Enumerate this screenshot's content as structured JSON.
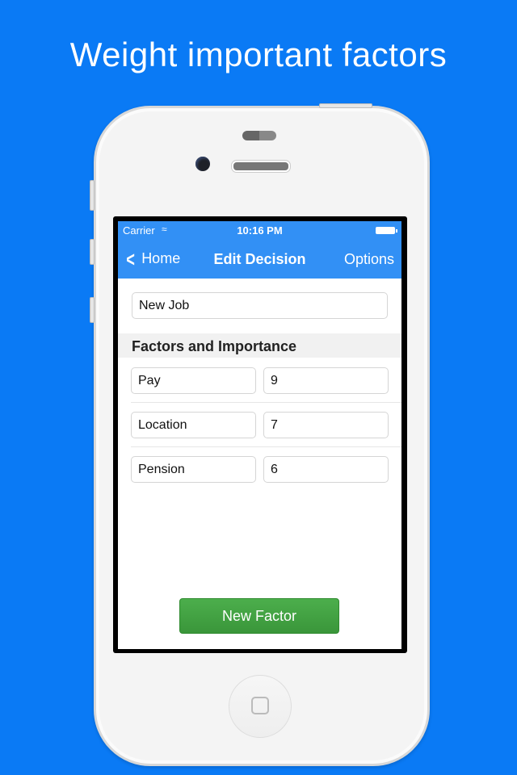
{
  "headline": "Weight important factors",
  "status_bar": {
    "carrier": "Carrier",
    "wifi_icon": "wifi-icon",
    "time": "10:16 PM",
    "battery_icon": "battery-icon"
  },
  "nav_bar": {
    "back_label": "Home",
    "back_icon": "chevron-left-icon",
    "title": "Edit Decision",
    "right_label": "Options"
  },
  "decision_name": {
    "value": "New Job"
  },
  "section_header": "Factors and Importance",
  "factors": [
    {
      "name": "Pay",
      "importance": "9"
    },
    {
      "name": "Location",
      "importance": "7"
    },
    {
      "name": "Pension",
      "importance": "6"
    }
  ],
  "new_factor_label": "New Factor",
  "colors": {
    "background": "#0a7af5",
    "nav_bar": "#3290f5",
    "button_green": "#43a443"
  }
}
